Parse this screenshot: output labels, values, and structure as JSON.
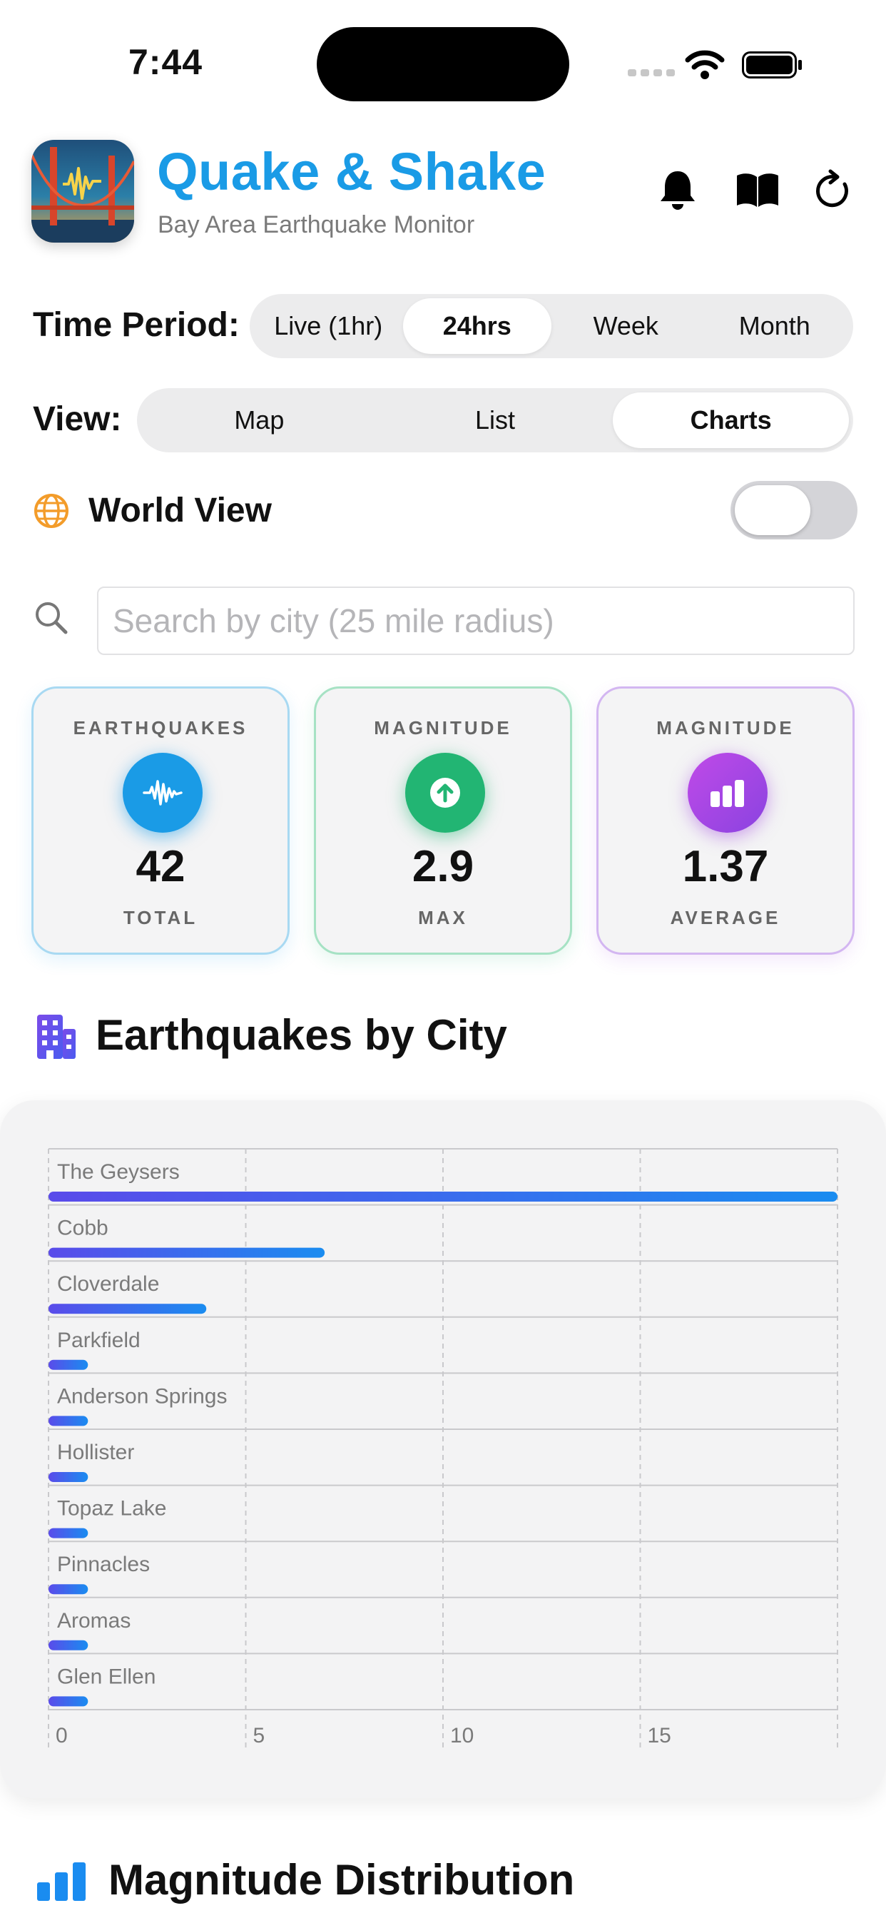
{
  "status_bar": {
    "time": "7:44"
  },
  "header": {
    "title": "Quake & Shake",
    "subtitle": "Bay Area Earthquake Monitor",
    "buttons": [
      "bell-icon",
      "book-icon",
      "refresh-icon"
    ]
  },
  "time_period": {
    "label": "Time Period:",
    "options": [
      "Live (1hr)",
      "24hrs",
      "Week",
      "Month"
    ],
    "selected": "24hrs"
  },
  "view": {
    "label": "View:",
    "options": [
      "Map",
      "List",
      "Charts"
    ],
    "selected": "Charts"
  },
  "world_view": {
    "label": "World View",
    "enabled": false
  },
  "search": {
    "placeholder": "Search by city (25 mile radius)",
    "value": ""
  },
  "stats": [
    {
      "label": "EARTHQUAKES",
      "value": "42",
      "sub": "TOTAL",
      "color": "#1a9be6",
      "icon": "waveform-icon"
    },
    {
      "label": "MAGNITUDE",
      "value": "2.9",
      "sub": "MAX",
      "color": "#22b573",
      "icon": "arrow-up-circle-icon"
    },
    {
      "label": "MAGNITUDE",
      "value": "1.37",
      "sub": "AVERAGE",
      "color": "#a14ae0",
      "icon": "chart-bar-icon"
    }
  ],
  "sections": {
    "by_city": "Earthquakes by City",
    "distribution": "Magnitude Distribution"
  },
  "colors": {
    "accent": "#1a9be6",
    "bar_start": "#5a4bea",
    "bar_end": "#1a8cf0"
  },
  "chart_data": {
    "type": "bar",
    "orientation": "horizontal",
    "categories": [
      "The Geysers",
      "Cobb",
      "Cloverdale",
      "Parkfield",
      "Anderson Springs",
      "Hollister",
      "Topaz Lake",
      "Pinnacles",
      "Aromas",
      "Glen Ellen"
    ],
    "values": [
      20,
      7,
      4,
      1,
      1,
      1,
      1,
      1,
      1,
      1
    ],
    "xlim": [
      0,
      20
    ],
    "x_ticks": [
      0,
      5,
      10,
      15
    ],
    "grid": true
  }
}
